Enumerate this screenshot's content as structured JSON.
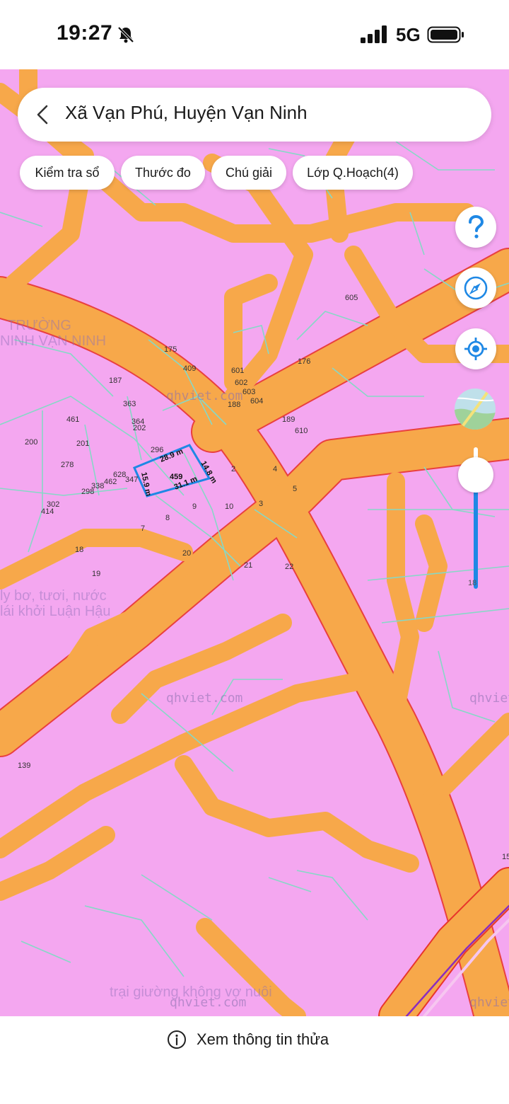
{
  "status_bar": {
    "time": "19:27",
    "network": "5G",
    "icons": [
      "bell-mute-icon",
      "signal-icon",
      "battery-icon"
    ]
  },
  "search": {
    "location": "Xã Vạn Phú, Huyện Vạn Ninh"
  },
  "chips": [
    {
      "label": "Kiểm tra sổ"
    },
    {
      "label": "Thước đo"
    },
    {
      "label": "Chú giải"
    },
    {
      "label": "Lớp Q.Hoạch(4)"
    }
  ],
  "controls": {
    "help_icon": "question-mark-icon",
    "compass_icon": "compass-icon",
    "locate_icon": "my-location-icon",
    "layer_thumb": "satellite-thumbnail",
    "zoom_value": "18"
  },
  "map": {
    "watermarks": [
      "qhviet.com",
      "qhviet.com",
      "qhviet.com",
      "qhviet.com",
      "qhviet.com"
    ],
    "faded_texts": [
      "TRƯỜNG",
      "NINH VẠN NINH",
      "ly bơ, tươi, nước",
      "lái khởi Luận Hậu",
      "trại giường không vợ nuôi"
    ],
    "lot_numbers": [
      "605",
      "176",
      "175",
      "409",
      "601",
      "602",
      "603",
      "604",
      "188",
      "187",
      "363",
      "461",
      "364",
      "202",
      "189",
      "610",
      "200",
      "201",
      "296",
      "278",
      "628",
      "347",
      "462",
      "338",
      "298",
      "302",
      "414",
      "2",
      "4",
      "5",
      "459",
      "9",
      "10",
      "3",
      "8",
      "7",
      "20",
      "18",
      "19",
      "21",
      "22",
      "139",
      "15"
    ],
    "measurements": [
      "28.9 m",
      "14.8 m",
      "31.1 m",
      "15.9 m"
    ],
    "colors": {
      "residential": "#f4a7f0",
      "road": "#f7a84a",
      "parcel_line": "#86d8c6",
      "road_edge": "#e8352b",
      "selection": "#1e88e5",
      "railway": "#8a2cbf"
    }
  },
  "bottom": {
    "action_label": "Xem thông tin thửa",
    "icon": "info-circle-icon"
  }
}
